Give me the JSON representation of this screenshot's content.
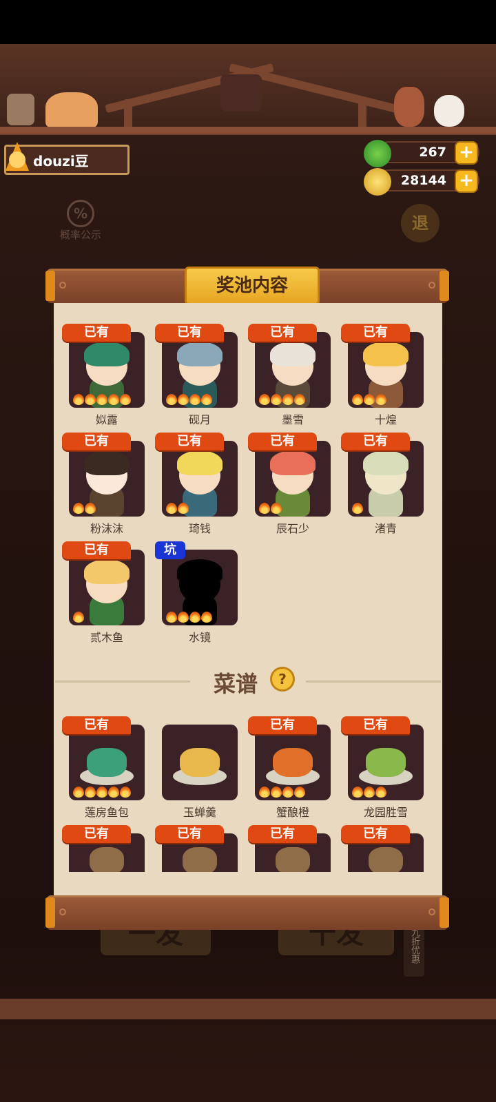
{
  "header": {
    "username": "douzi豆",
    "currency": [
      {
        "icon": "jade-coin-icon",
        "value": "267"
      },
      {
        "icon": "gold-coin-icon",
        "value": "28144"
      }
    ],
    "plus_label": "+",
    "rate_label": "概率公示",
    "rate_symbol": "%",
    "retreat_label": "退"
  },
  "modal": {
    "title": "奖池内容",
    "owned_label": "已有",
    "pit_label": "坑",
    "characters": [
      {
        "name": "姒露",
        "badge": "owned",
        "stars": 5
      },
      {
        "name": "砚月",
        "badge": "owned",
        "stars": 4
      },
      {
        "name": "墨雪",
        "badge": "owned",
        "stars": 4
      },
      {
        "name": "十煌",
        "badge": "owned",
        "stars": 3
      },
      {
        "name": "粉沫沫",
        "badge": "owned",
        "stars": 2
      },
      {
        "name": "琦钱",
        "badge": "owned",
        "stars": 2
      },
      {
        "name": "辰石少",
        "badge": "owned",
        "stars": 2
      },
      {
        "name": "渚青",
        "badge": "owned",
        "stars": 1
      },
      {
        "name": "贰木鱼",
        "badge": "owned",
        "stars": 1
      },
      {
        "name": "水镜",
        "badge": "pit",
        "stars": 4
      }
    ],
    "recipe_section": "菜谱",
    "recipe_help": "?",
    "recipes": [
      {
        "name": "莲房鱼包",
        "badge": "owned",
        "stars": 5
      },
      {
        "name": "玉蝉羹",
        "badge": "none",
        "stars": 0
      },
      {
        "name": "蟹酿橙",
        "badge": "owned",
        "stars": 4
      },
      {
        "name": "龙园胜雪",
        "badge": "owned",
        "stars": 3
      },
      {
        "name": "",
        "badge": "owned",
        "stars": 0
      },
      {
        "name": "",
        "badge": "owned",
        "stars": 0
      },
      {
        "name": "",
        "badge": "owned",
        "stars": 0
      },
      {
        "name": "",
        "badge": "owned",
        "stars": 0
      }
    ]
  },
  "footer": {
    "single_draw": "一发",
    "ten_draw": "十发",
    "discount": "九折优惠"
  },
  "colors": {
    "owned_badge": "#e04a12",
    "pit_badge": "#1a34d6",
    "paper": "#e8d9c0",
    "card": "#3b2226",
    "title_gold": "#f0b432"
  }
}
